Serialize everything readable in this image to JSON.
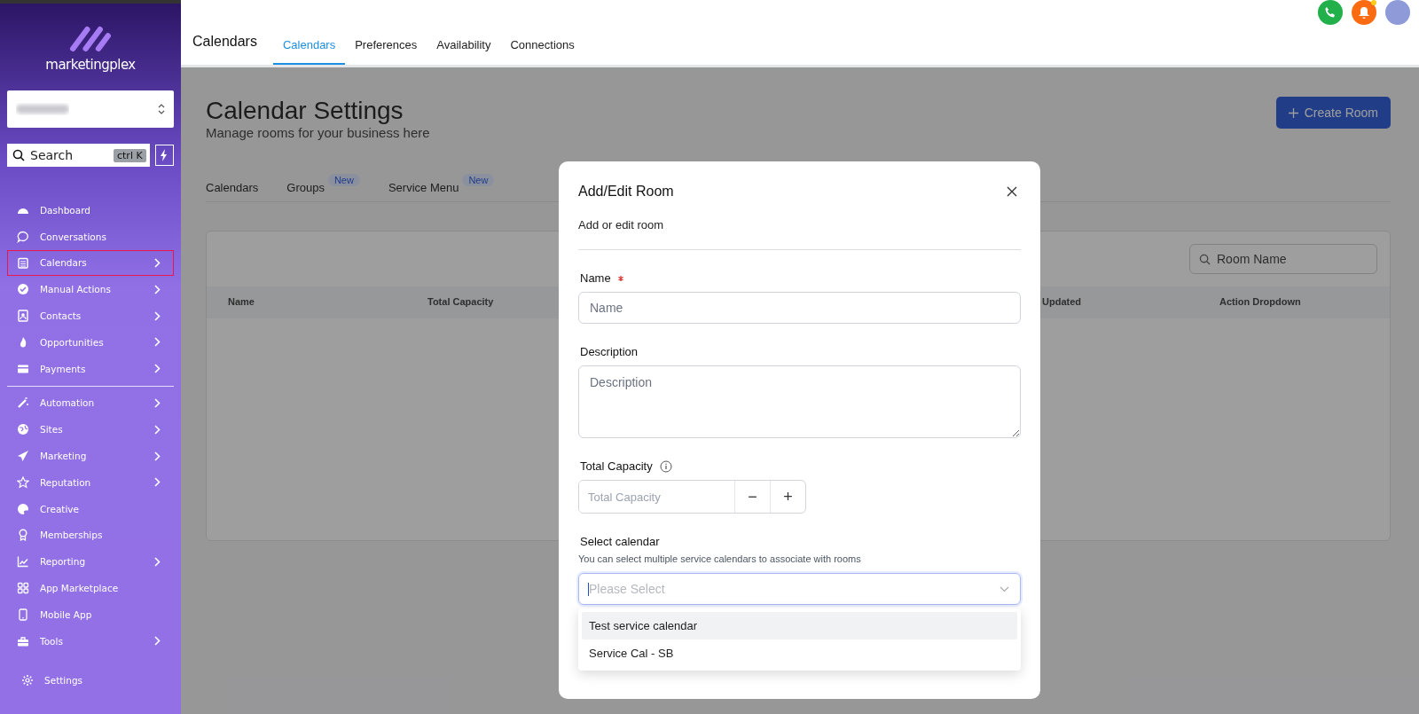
{
  "sidebar": {
    "logo": "marketingplex",
    "search": {
      "placeholder": "Search",
      "shortcut": "ctrl K"
    },
    "groups": [
      [
        {
          "label": "Dashboard",
          "has_submenu": false,
          "selected": false
        },
        {
          "label": "Conversations",
          "has_submenu": false,
          "selected": false
        },
        {
          "label": "Calendars",
          "has_submenu": true,
          "selected": true
        },
        {
          "label": "Manual Actions",
          "has_submenu": true,
          "selected": false
        },
        {
          "label": "Contacts",
          "has_submenu": true,
          "selected": false
        },
        {
          "label": "Opportunities",
          "has_submenu": true,
          "selected": false
        },
        {
          "label": "Payments",
          "has_submenu": true,
          "selected": false
        }
      ],
      [
        {
          "label": "Automation",
          "has_submenu": true,
          "selected": false
        },
        {
          "label": "Sites",
          "has_submenu": true,
          "selected": false
        },
        {
          "label": "Marketing",
          "has_submenu": true,
          "selected": false
        },
        {
          "label": "Reputation",
          "has_submenu": true,
          "selected": false
        },
        {
          "label": "Creative",
          "has_submenu": false,
          "selected": false
        },
        {
          "label": "Memberships",
          "has_submenu": false,
          "selected": false
        },
        {
          "label": "Reporting",
          "has_submenu": true,
          "selected": false
        },
        {
          "label": "App Marketplace",
          "has_submenu": false,
          "selected": false
        },
        {
          "label": "Mobile App",
          "has_submenu": false,
          "selected": false
        },
        {
          "label": "Tools",
          "has_submenu": true,
          "selected": false
        }
      ]
    ],
    "settings": "Settings"
  },
  "header": {
    "title": "Calendars",
    "tabs": [
      {
        "label": "Calendars",
        "selected": true
      },
      {
        "label": "Preferences",
        "selected": false
      },
      {
        "label": "Availability",
        "selected": false
      },
      {
        "label": "Connections",
        "selected": false
      }
    ],
    "notification_dot": true
  },
  "page": {
    "title": "Calendar Settings",
    "subtitle": "Manage rooms for your business here",
    "create_button": "Create Room",
    "subtabs": [
      {
        "label": "Calendars"
      },
      {
        "label": "Groups",
        "badge": "New"
      },
      {
        "label": "Service Menu",
        "badge": "New"
      }
    ],
    "table": {
      "search_placeholder": "Room Name",
      "columns": [
        "Name",
        "Total Capacity",
        "Updated",
        "Action Dropdown"
      ]
    }
  },
  "modal": {
    "title": "Add/Edit Room",
    "subtitle": "Add or edit room",
    "name": {
      "label": "Name",
      "required": true,
      "placeholder": "Name"
    },
    "description": {
      "label": "Description",
      "placeholder": "Description"
    },
    "capacity": {
      "label": "Total Capacity",
      "placeholder": "Total Capacity",
      "decrement": "−",
      "increment": "+"
    },
    "calendar": {
      "label": "Select calendar",
      "help": "You can select multiple service calendars to associate with rooms",
      "placeholder": "Please Select",
      "options": [
        {
          "label": "Test service calendar",
          "highlighted": true
        },
        {
          "label": "Service Cal - SB",
          "highlighted": false
        }
      ]
    }
  }
}
